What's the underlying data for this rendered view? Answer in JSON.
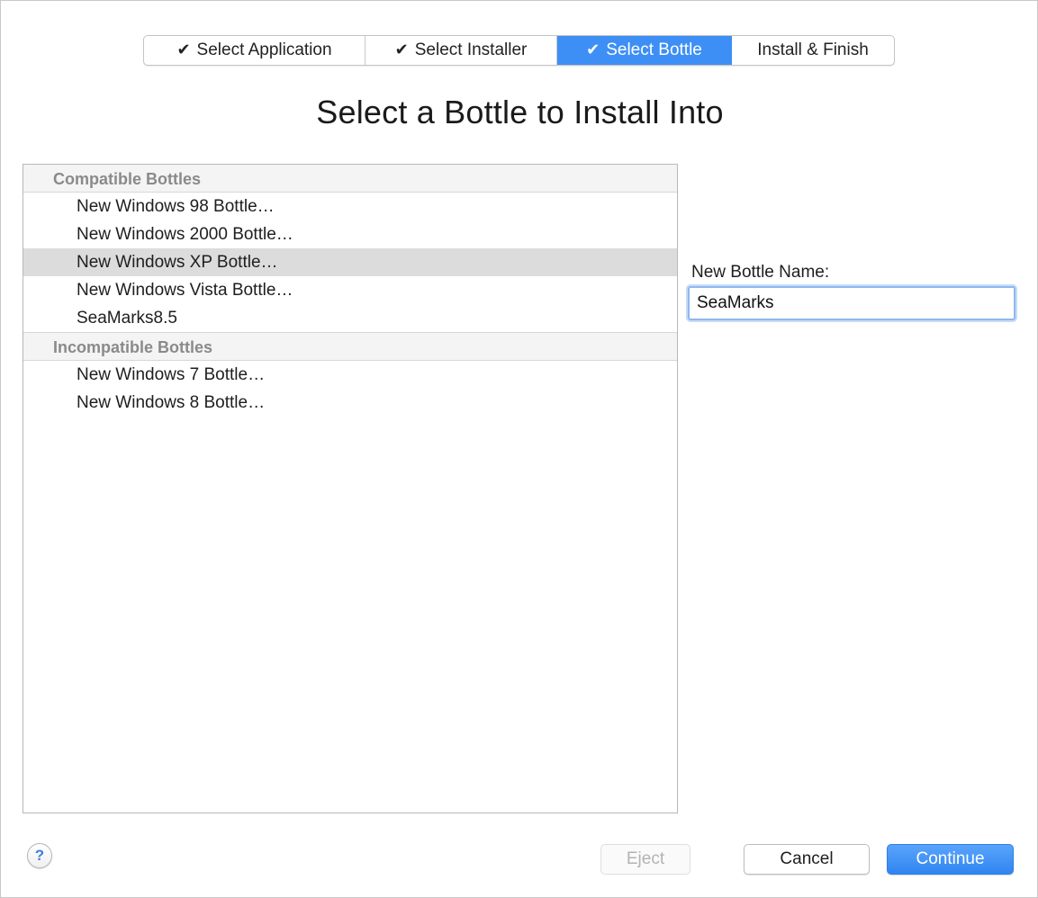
{
  "steps": [
    {
      "label": "Select Application",
      "check": "✔",
      "active": false
    },
    {
      "label": "Select Installer",
      "check": "✔",
      "active": false
    },
    {
      "label": "Select Bottle",
      "check": "✔",
      "active": true
    },
    {
      "label": "Install & Finish",
      "check": "",
      "active": false
    }
  ],
  "page": {
    "title": "Select a Bottle to Install Into"
  },
  "bottles": {
    "compatible_header": "Compatible Bottles",
    "compatible": [
      {
        "label": "New Windows 98 Bottle…",
        "selected": false
      },
      {
        "label": "New Windows 2000 Bottle…",
        "selected": false
      },
      {
        "label": "New Windows XP Bottle…",
        "selected": true
      },
      {
        "label": "New Windows Vista Bottle…",
        "selected": false
      },
      {
        "label": "SeaMarks8.5",
        "selected": false
      }
    ],
    "incompatible_header": "Incompatible Bottles",
    "incompatible": [
      {
        "label": "New Windows 7 Bottle…",
        "selected": false
      },
      {
        "label": "New Windows 8 Bottle…",
        "selected": false
      }
    ]
  },
  "name_field": {
    "label": "New Bottle Name:",
    "value": "SeaMarks"
  },
  "footer": {
    "help_label": "?",
    "eject_label": "Eject",
    "cancel_label": "Cancel",
    "continue_label": "Continue"
  },
  "colors": {
    "accent": "#3d8ff5",
    "selection": "#dcdcdc"
  }
}
